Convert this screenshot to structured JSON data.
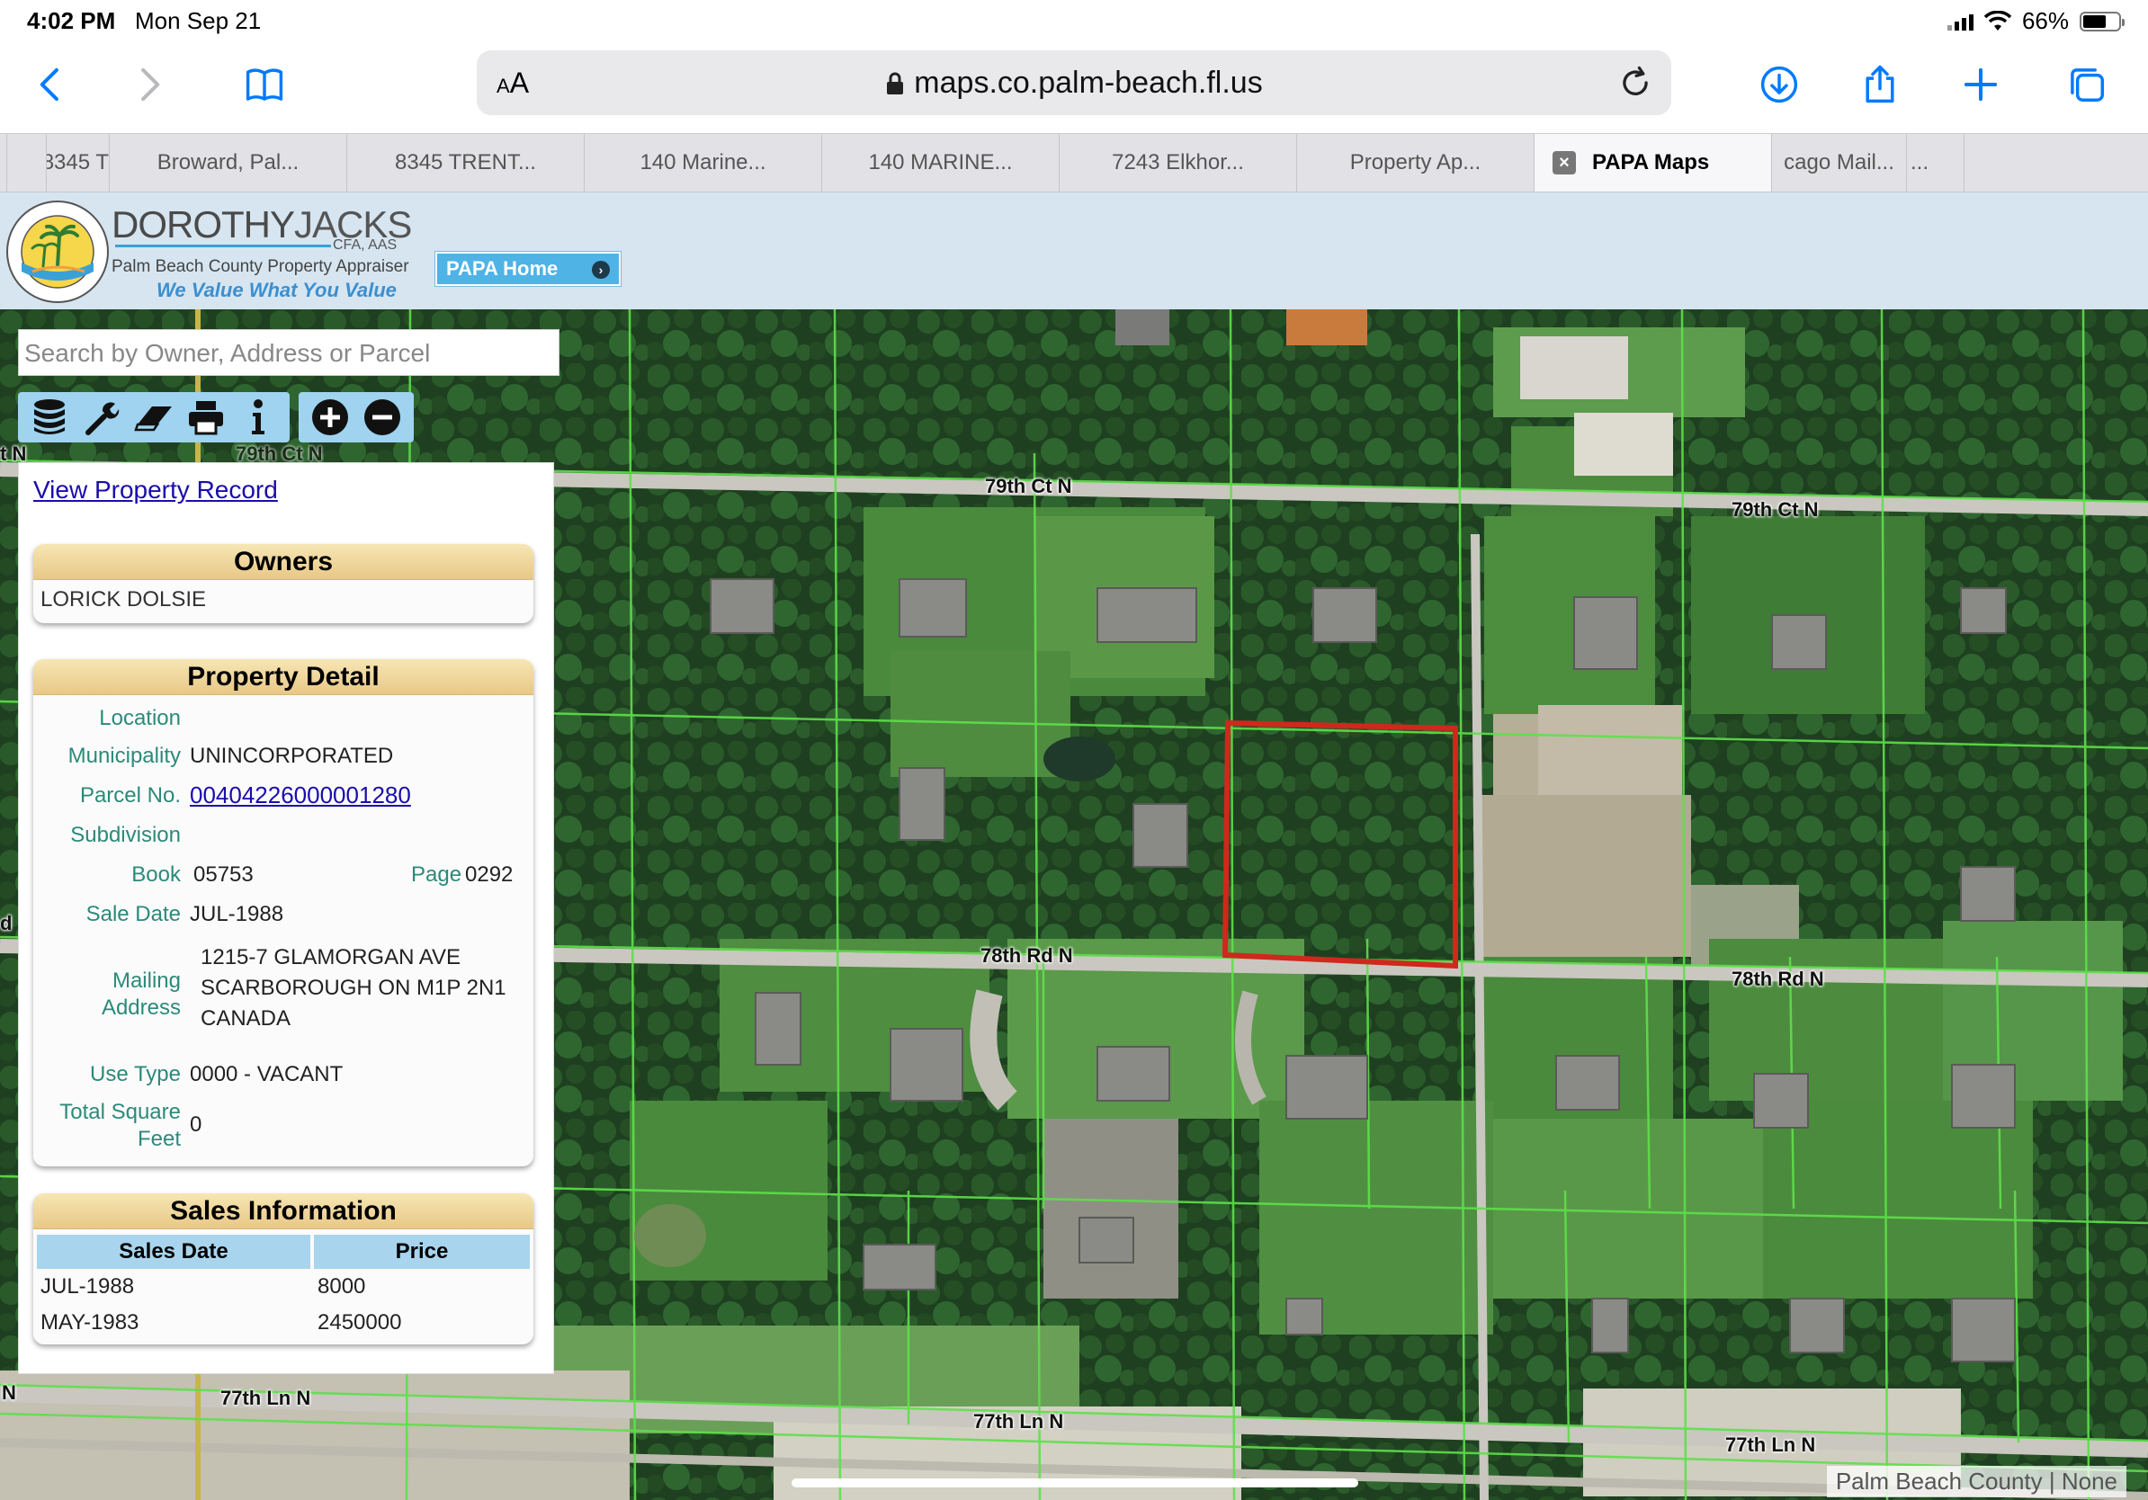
{
  "status_bar": {
    "time": "4:02 PM",
    "date": "Mon Sep 21",
    "battery": "66%"
  },
  "browser": {
    "aa": "AA",
    "url": "maps.co.palm-beach.fl.us"
  },
  "tabs": [
    {
      "label": "",
      "active": false
    },
    {
      "label": "",
      "active": false
    },
    {
      "label": "8345 T",
      "active": false
    },
    {
      "label": "Broward, Pal...",
      "active": false
    },
    {
      "label": "8345 TRENT...",
      "active": false
    },
    {
      "label": "140 Marine...",
      "active": false
    },
    {
      "label": "140 MARINE...",
      "active": false
    },
    {
      "label": "7243 Elkhor...",
      "active": false
    },
    {
      "label": "Property Ap...",
      "active": false
    },
    {
      "label": "PAPA Maps",
      "active": true
    },
    {
      "label": "cago Mail...",
      "active": false
    },
    {
      "label": "...",
      "active": false
    }
  ],
  "header": {
    "name_first": "DOROTHY",
    "name_last": "JACKS",
    "credentials": "CFA, AAS",
    "agency": "Palm Beach County Property Appraiser",
    "tagline": "We Value What You Value",
    "home_button": "PAPA Home"
  },
  "map": {
    "search_placeholder": "Search by Owner, Address or Parcel",
    "road_labels": {
      "r79_left": "79th Ct N",
      "r79_mid": "79th Ct N",
      "r79_right": "79th Ct N",
      "r78_mid": "78th Rd N",
      "r78_right": "78th Rd N",
      "r77_left": "77th Ln N",
      "r77_mid": "77th Ln N",
      "r77_right": "77th Ln N",
      "edge_n1": "t N",
      "edge_n2": "N",
      "edge_d": "d"
    },
    "attribution": "Palm Beach County | None",
    "tools": [
      "database-icon",
      "wrench-icon",
      "eraser-icon",
      "print-icon",
      "info-icon",
      "zoom-in-icon",
      "zoom-out-icon"
    ]
  },
  "panel": {
    "view_record": "View Property Record",
    "owners": {
      "title": "Owners",
      "name": "LORICK DOLSIE"
    },
    "detail": {
      "title": "Property Detail",
      "location_label": "Location",
      "location_value": "",
      "municipality_label": "Municipality",
      "municipality_value": "UNINCORPORATED",
      "parcel_label": "Parcel No.",
      "parcel_value": "00404226000001280",
      "subdivision_label": "Subdivision",
      "subdivision_value": "",
      "book_label": "Book",
      "book_value": "05753",
      "page_label": "Page",
      "page_value": "0292",
      "sale_date_label": "Sale Date",
      "sale_date_value": "JUL-1988",
      "mailing_label_1": "Mailing",
      "mailing_label_2": "Address",
      "mailing_line_1": "1215-7 GLAMORGAN AVE",
      "mailing_line_2": "SCARBOROUGH ON M1P 2N1",
      "mailing_line_3": "CANADA",
      "use_type_label": "Use Type",
      "use_type_value": "0000 - VACANT",
      "sqft_label_1": "Total Square",
      "sqft_label_2": "Feet",
      "sqft_value": "0"
    },
    "sales": {
      "title": "Sales Information",
      "col_date": "Sales Date",
      "col_price": "Price",
      "rows": [
        {
          "date": "JUL-1988",
          "price": "8000"
        },
        {
          "date": "MAY-1983",
          "price": "2450000"
        }
      ]
    }
  },
  "colors": {
    "accent": "#007aff",
    "parcel_outline": "#d0281c",
    "parcel_lines": "#5ee04a",
    "panel_header": "#f0d99a",
    "table_header": "#a8d4ee"
  }
}
